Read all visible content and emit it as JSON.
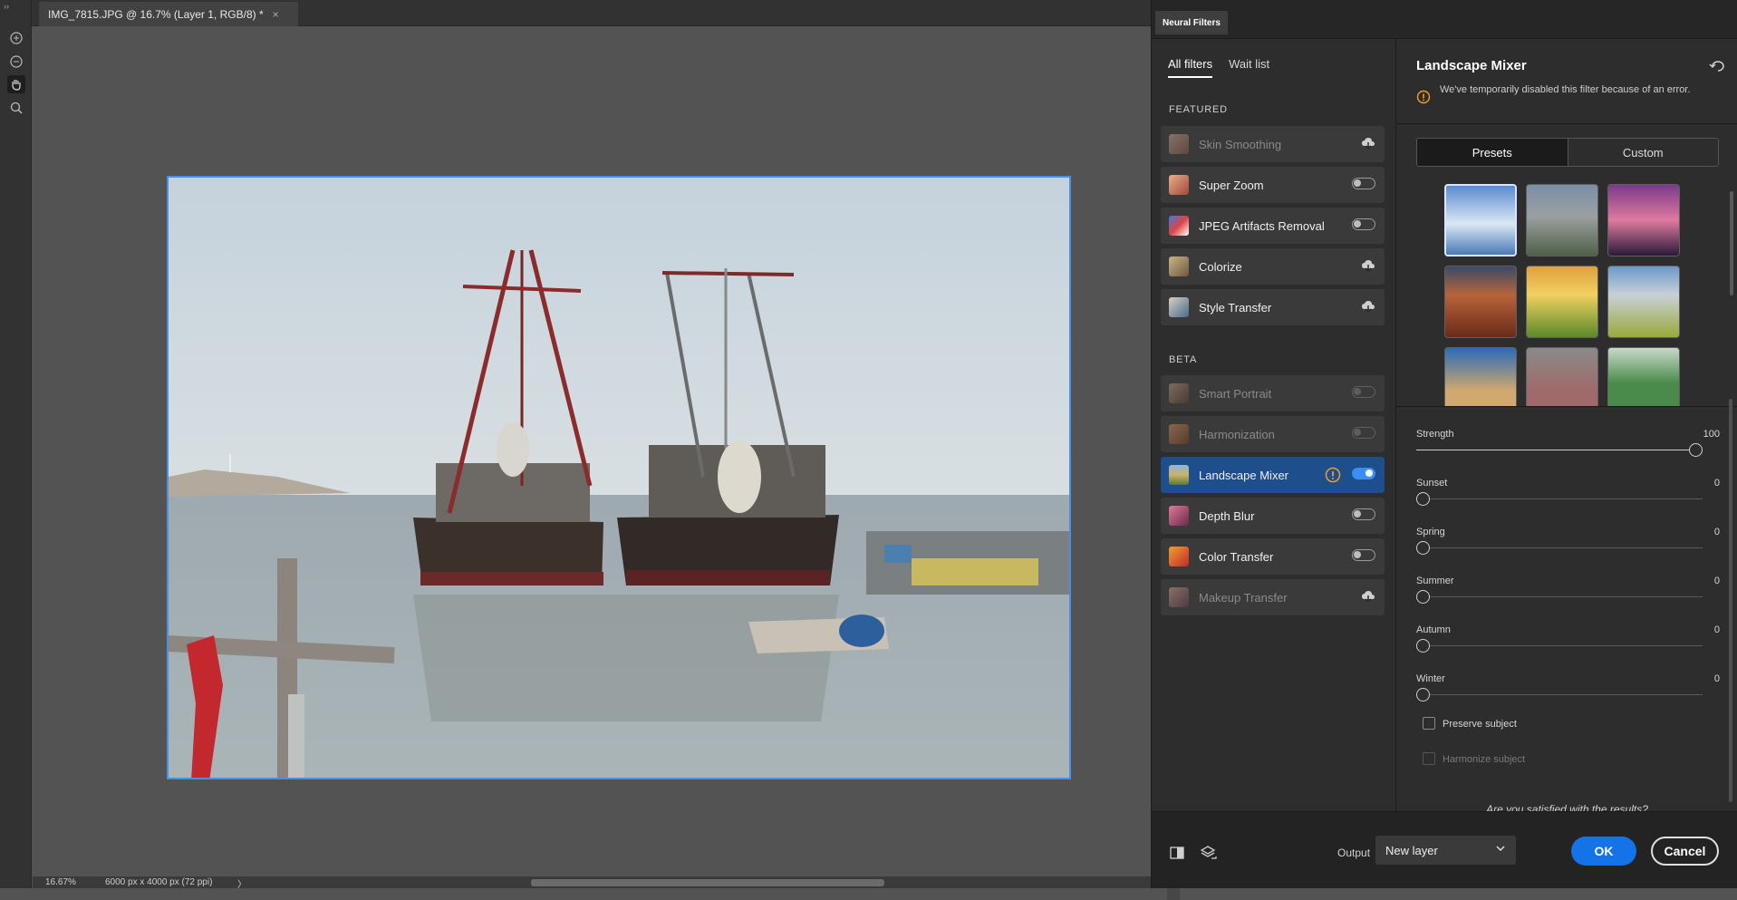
{
  "document": {
    "tab_title": "IMG_7815.JPG @ 16.7% (Layer 1, RGB/8) *",
    "close_glyph": "×",
    "zoom": "16.67%",
    "dimensions": "6000 px x 4000 px (72 ppi)",
    "status_arrow": "〉"
  },
  "tools": [
    "zoom-in-icon",
    "zoom-out-icon",
    "hand-icon",
    "magnifier-icon"
  ],
  "panel": {
    "title": "Neural Filters",
    "tabs": [
      "All filters",
      "Wait list"
    ],
    "featured_label": "FEATURED",
    "beta_label": "BETA",
    "featured": [
      {
        "name": "Skin Smoothing",
        "state": "cloud",
        "dim": true
      },
      {
        "name": "Super Zoom",
        "state": "off",
        "dim": false
      },
      {
        "name": "JPEG Artifacts Removal",
        "state": "off",
        "dim": false
      },
      {
        "name": "Colorize",
        "state": "cloud",
        "dim": false
      },
      {
        "name": "Style Transfer",
        "state": "cloud",
        "dim": false
      }
    ],
    "beta": [
      {
        "name": "Smart Portrait",
        "state": "off",
        "dim": true
      },
      {
        "name": "Harmonization",
        "state": "off",
        "dim": true
      },
      {
        "name": "Landscape Mixer",
        "state": "on",
        "dim": false,
        "selected": true,
        "warning": true
      },
      {
        "name": "Depth Blur",
        "state": "off",
        "dim": false
      },
      {
        "name": "Color Transfer",
        "state": "off",
        "dim": false
      },
      {
        "name": "Makeup Transfer",
        "state": "cloud",
        "dim": true
      }
    ]
  },
  "detail": {
    "title": "Landscape Mixer",
    "warning": "We've temporarily disabled this filter because of an error.",
    "segments": [
      "Presets",
      "Custom"
    ],
    "sliders": [
      {
        "label": "Strength",
        "value": "100",
        "fraction": 1.0
      },
      {
        "label": "Sunset",
        "value": "0",
        "fraction": 0
      },
      {
        "label": "Spring",
        "value": "0",
        "fraction": 0
      },
      {
        "label": "Summer",
        "value": "0",
        "fraction": 0
      },
      {
        "label": "Autumn",
        "value": "0",
        "fraction": 0
      },
      {
        "label": "Winter",
        "value": "0",
        "fraction": 0
      }
    ],
    "checkboxes": [
      {
        "label": "Preserve subject",
        "checked": false,
        "dim": false
      },
      {
        "label": "Harmonize subject",
        "checked": false,
        "dim": true
      }
    ],
    "satisfied": "Are you satisfied with the results?"
  },
  "footer": {
    "output_label": "Output",
    "output_value": "New layer",
    "ok": "OK",
    "cancel": "Cancel"
  },
  "colors": {
    "accent": "#1473e6",
    "selection": "#1f4e8c",
    "warning": "#f0a020"
  }
}
